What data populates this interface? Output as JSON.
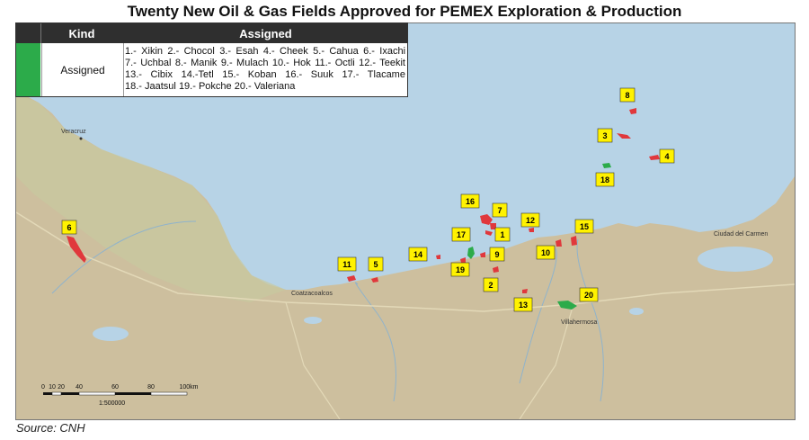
{
  "title": "Twenty New Oil & Gas Fields Approved for PEMEX Exploration & Production",
  "legend": {
    "col_kind": "Kind",
    "col_assigned": "Assigned",
    "kind_value": "Assigned",
    "swatch_color": "#2cab4a",
    "fields": [
      "1.- Xikin",
      "2.- Chocol",
      "3.- Esah",
      "4.- Cheek",
      "5.- Cahua",
      "6.- Ixachi",
      "7.- Uchbal",
      "8.- Manik",
      "9.- Mulach",
      "10.- Hok",
      "11.- Octli",
      "12.- Teekit",
      "13.- Cibix",
      "14.-Tetl",
      "15.- Koban",
      "16.- Suuk",
      "17.- Tlacame",
      "18.- Jaatsul",
      "19.- Pokche",
      "20.- Valeriana"
    ]
  },
  "map": {
    "colors": {
      "sea": "#b7d3e6",
      "land": "#cdbf9e",
      "field_red": "#e0383c",
      "field_green": "#2cab4a",
      "badge": "#fff200"
    },
    "cities": [
      "Veracruz",
      "Coatzacoalcos",
      "Villahermosa",
      "Ciudad del Carmen"
    ],
    "scale": {
      "ticks": [
        "0",
        "10",
        "20",
        "40",
        "60",
        "80",
        "100km"
      ],
      "ratio": "1:500000"
    },
    "markers": [
      {
        "id": "1",
        "label": "1"
      },
      {
        "id": "2",
        "label": "2"
      },
      {
        "id": "3",
        "label": "3"
      },
      {
        "id": "4",
        "label": "4"
      },
      {
        "id": "5",
        "label": "5"
      },
      {
        "id": "6",
        "label": "6"
      },
      {
        "id": "7",
        "label": "7"
      },
      {
        "id": "8",
        "label": "8"
      },
      {
        "id": "9",
        "label": "9"
      },
      {
        "id": "10",
        "label": "10"
      },
      {
        "id": "11",
        "label": "11"
      },
      {
        "id": "12",
        "label": "12"
      },
      {
        "id": "13",
        "label": "13"
      },
      {
        "id": "14",
        "label": "14"
      },
      {
        "id": "15",
        "label": "15"
      },
      {
        "id": "16",
        "label": "16"
      },
      {
        "id": "17",
        "label": "17"
      },
      {
        "id": "18",
        "label": "18"
      },
      {
        "id": "19",
        "label": "19"
      },
      {
        "id": "20",
        "label": "20"
      }
    ]
  },
  "source": "Source: CNH"
}
